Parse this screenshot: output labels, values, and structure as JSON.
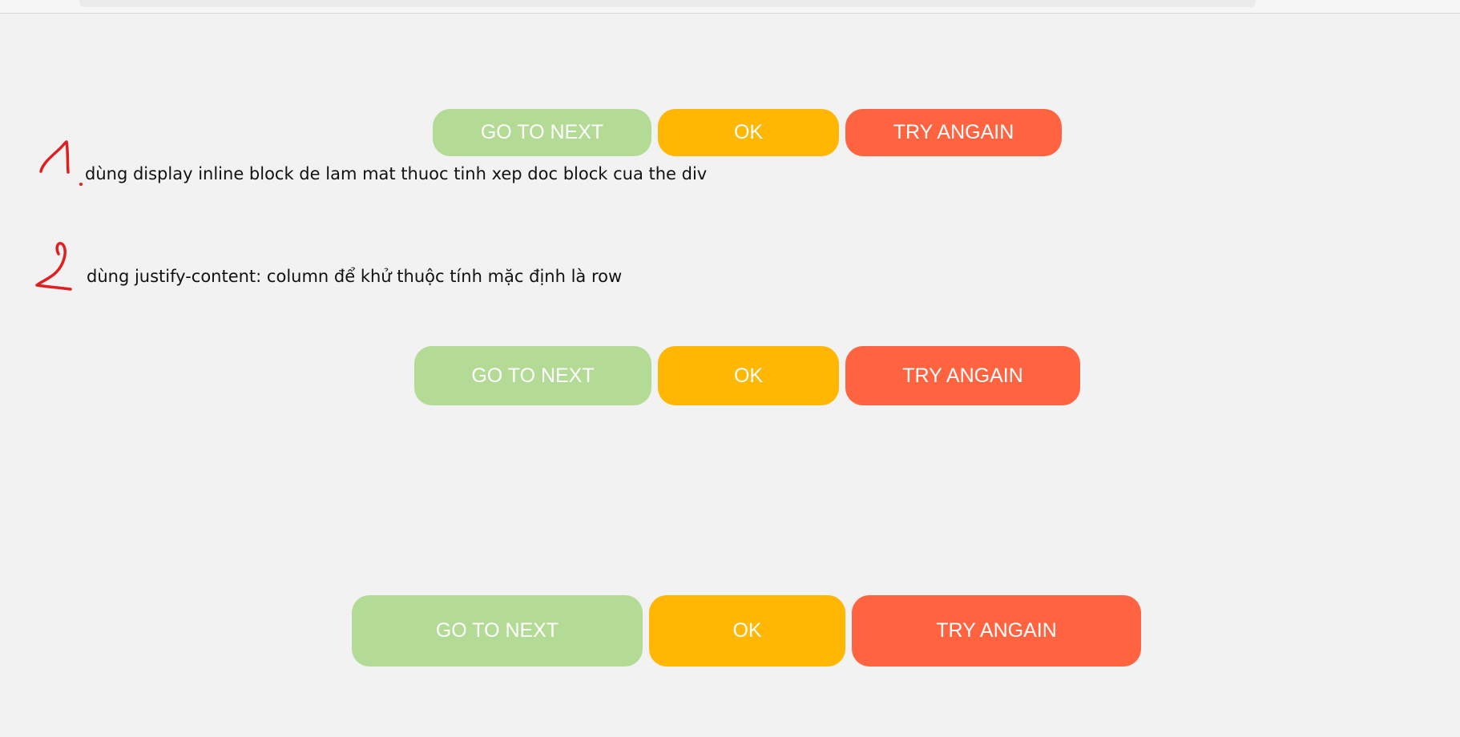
{
  "buttons": {
    "row1": {
      "next": "GO TO NEXT",
      "ok": "OK",
      "retry": "TRY ANGAIN"
    },
    "row2": {
      "next": "GO TO NEXT",
      "ok": "OK",
      "retry": "TRY ANGAIN"
    },
    "row3": {
      "next": "GO TO NEXT",
      "ok": "OK",
      "retry": "TRY ANGAIN"
    }
  },
  "notes": {
    "note1": "dùng display inline block de lam mat thuoc tinh xep doc block cua the div",
    "note2": "dùng justify-content: column để khử thuộc tính mặc định là row"
  },
  "annotations": {
    "note1_number": "1",
    "note2_number": "2"
  },
  "colors": {
    "background": "#f2f2f2",
    "next_button": "#b4db96",
    "ok_button": "#ffb703",
    "retry_button": "#ff6340",
    "annotation_ink": "#e02020"
  }
}
